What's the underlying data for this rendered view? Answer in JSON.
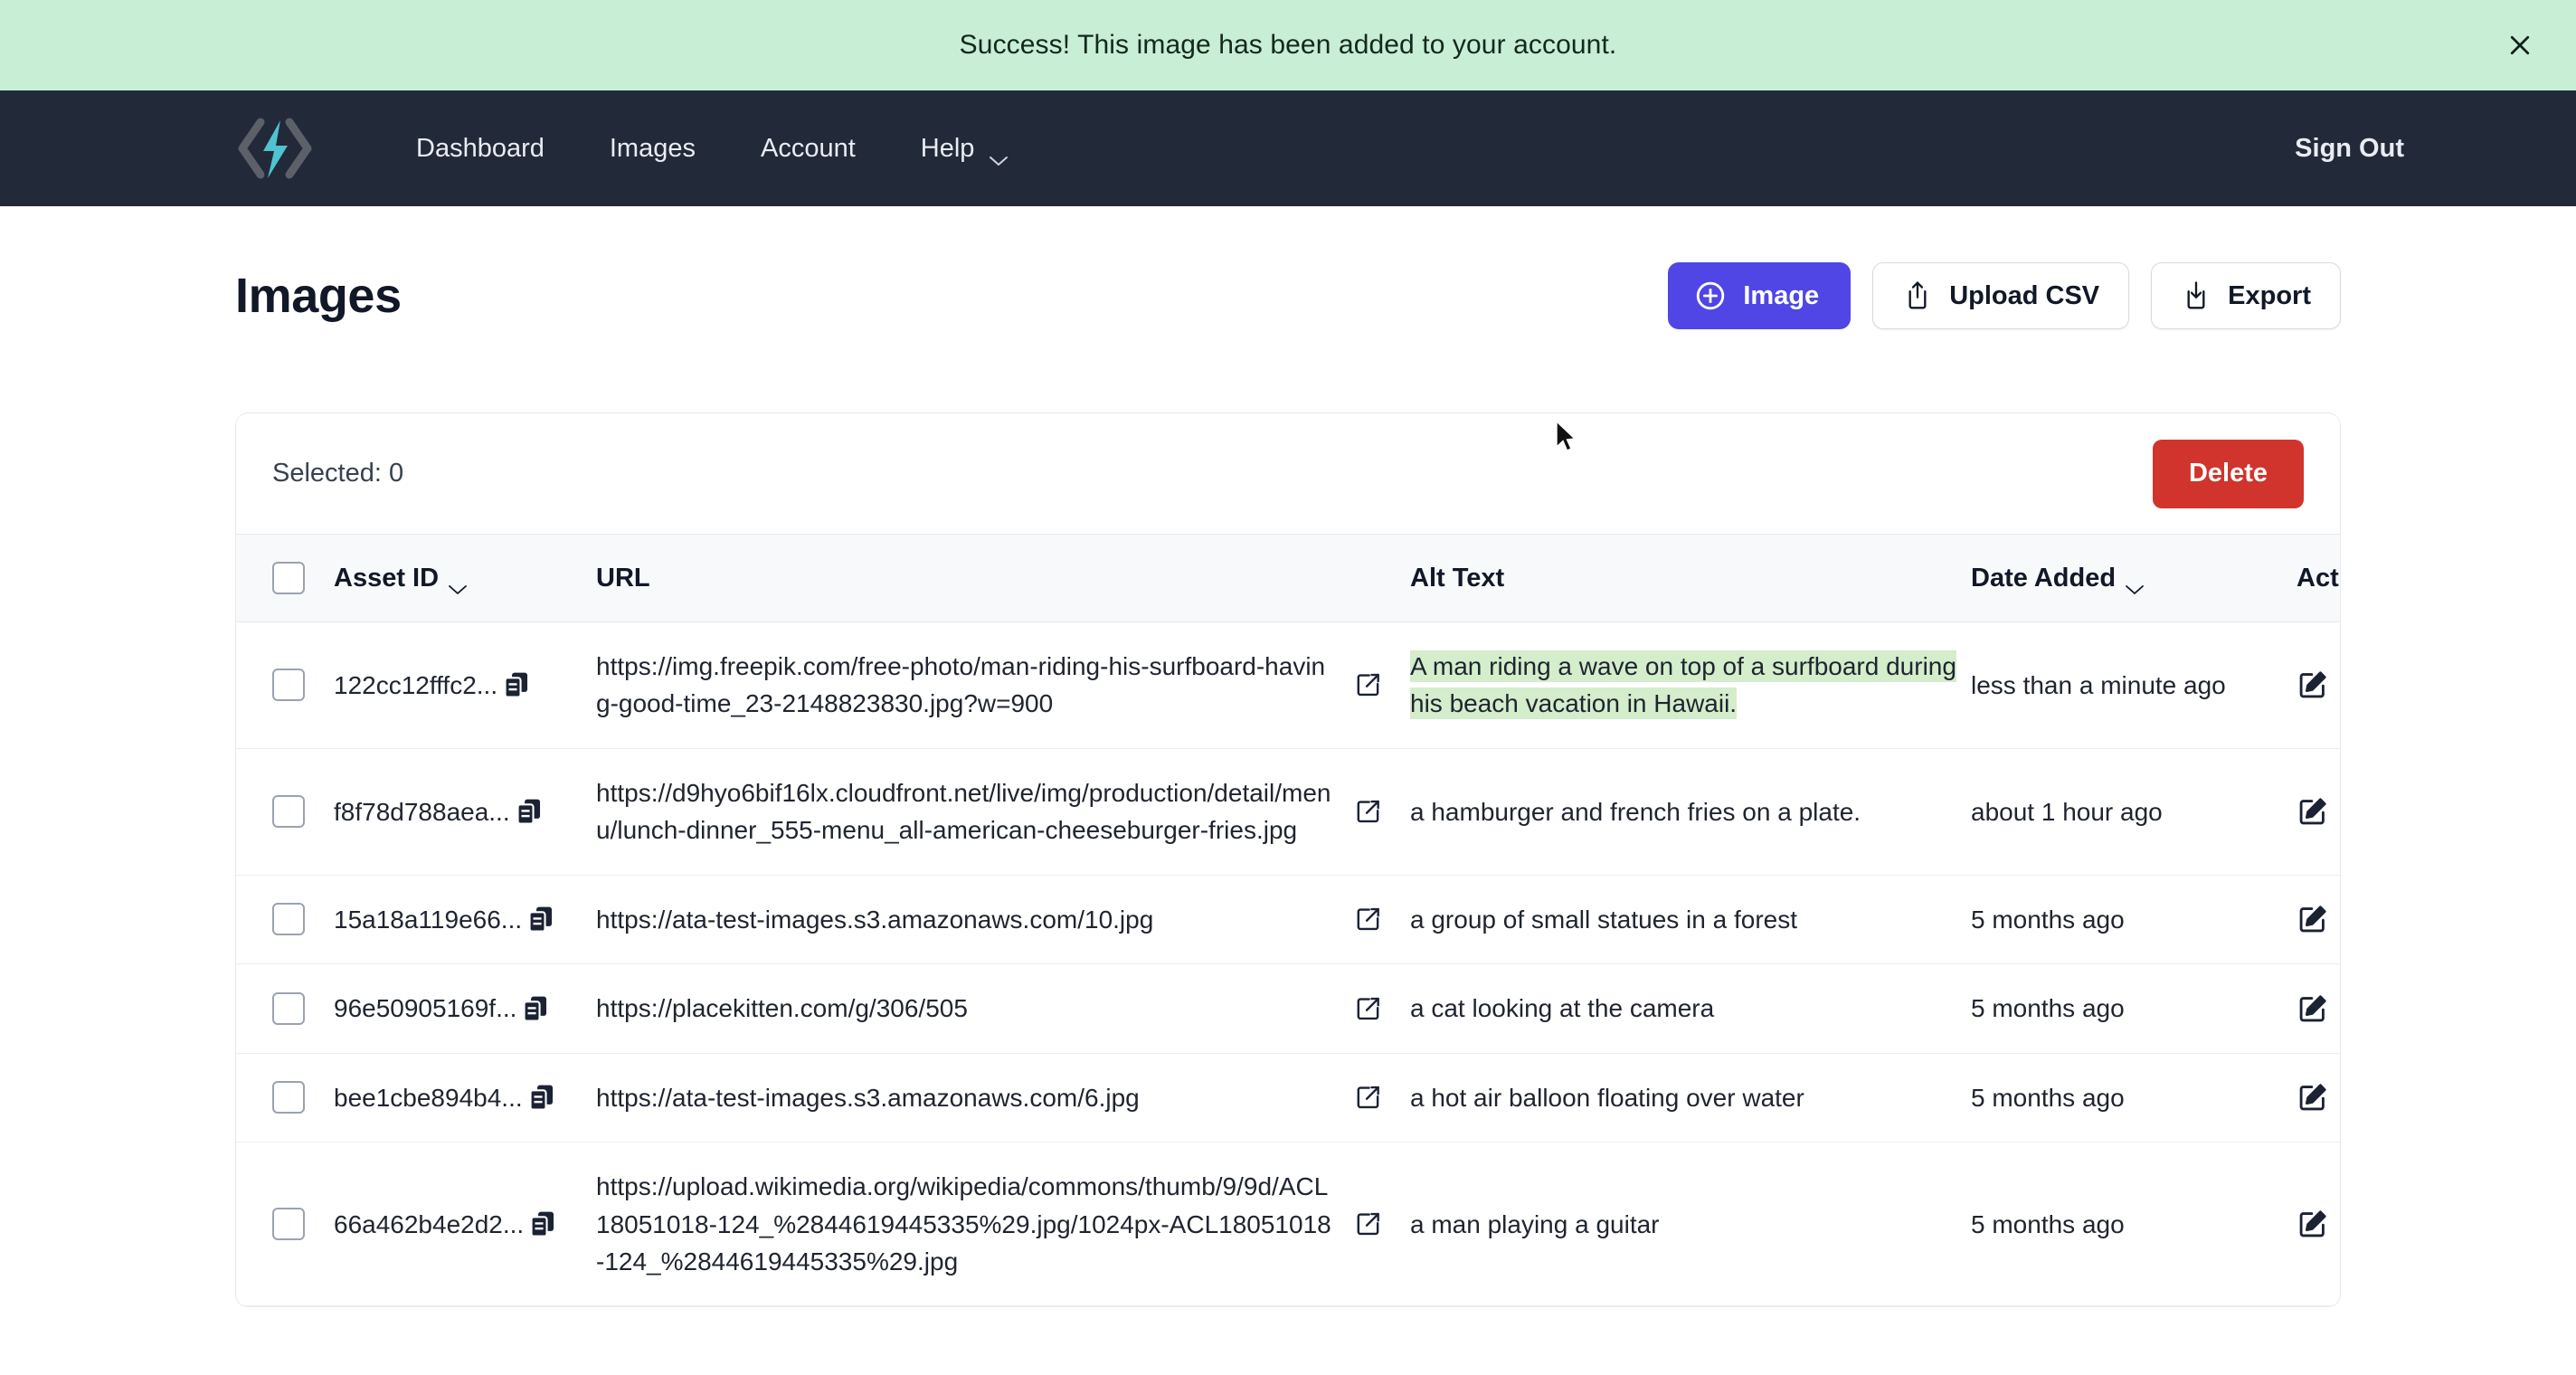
{
  "banner": {
    "message": "Success! This image has been added to your account.",
    "close_icon": "close-icon",
    "bg_color": "#c9eed6"
  },
  "navbar": {
    "logo_icon": "lightning-bolt-code-logo",
    "brand_accent_color": "#4fc3d0",
    "bg_color": "#222938",
    "links": [
      {
        "label": "Dashboard",
        "caret": false
      },
      {
        "label": "Images",
        "caret": false
      },
      {
        "label": "Account",
        "caret": false
      },
      {
        "label": "Help",
        "caret": true
      }
    ],
    "signout_label": "Sign Out"
  },
  "header": {
    "title": "Images",
    "buttons": [
      {
        "label": "Image",
        "icon": "plus-circle-icon",
        "style": "primary",
        "color": "#4f46e5"
      },
      {
        "label": "Upload CSV",
        "icon": "upload-icon",
        "style": "secondary"
      },
      {
        "label": "Export",
        "icon": "download-icon",
        "style": "secondary"
      }
    ]
  },
  "toolbar": {
    "selected_label": "Selected: 0",
    "delete_label": "Delete",
    "delete_color": "#d0342c"
  },
  "table": {
    "columns": [
      {
        "key": "checkbox",
        "label": "",
        "sortable": false
      },
      {
        "key": "asset_id",
        "label": "Asset ID",
        "sortable": true
      },
      {
        "key": "url",
        "label": "URL",
        "sortable": false
      },
      {
        "key": "alt_text",
        "label": "Alt Text",
        "sortable": false
      },
      {
        "key": "date_added",
        "label": "Date Added",
        "sortable": true
      },
      {
        "key": "actions",
        "label": "Actions",
        "sortable": false
      }
    ],
    "row_actions": [
      "edit-icon",
      "users-icon",
      "trash-icon"
    ],
    "rows": [
      {
        "checked": false,
        "asset_id": "122cc12fffc2...",
        "url": "https://img.freepik.com/free-photo/man-riding-his-surfboard-having-good-time_23-2148823830.jpg?w=900",
        "alt_text": "A man riding a wave on top of a surfboard during his beach vacation in Hawaii.",
        "alt_highlighted": true,
        "date_added": "less than a minute ago"
      },
      {
        "checked": false,
        "asset_id": "f8f78d788aea...",
        "url": "https://d9hyo6bif16lx.cloudfront.net/live/img/production/detail/menu/lunch-dinner_555-menu_all-american-cheeseburger-fries.jpg",
        "alt_text": "a hamburger and french fries on a plate.",
        "alt_highlighted": false,
        "date_added": "about 1 hour ago"
      },
      {
        "checked": false,
        "asset_id": "15a18a119e66...",
        "url": "https://ata-test-images.s3.amazonaws.com/10.jpg",
        "alt_text": "a group of small statues in a forest",
        "alt_highlighted": false,
        "date_added": "5 months ago"
      },
      {
        "checked": false,
        "asset_id": "96e50905169f...",
        "url": "https://placekitten.com/g/306/505",
        "alt_text": "a cat looking at the camera",
        "alt_highlighted": false,
        "date_added": "5 months ago"
      },
      {
        "checked": false,
        "asset_id": "bee1cbe894b4...",
        "url": "https://ata-test-images.s3.amazonaws.com/6.jpg",
        "alt_text": "a hot air balloon floating over water",
        "alt_highlighted": false,
        "date_added": "5 months ago"
      },
      {
        "checked": false,
        "asset_id": "66a462b4e2d2...",
        "url": "https://upload.wikimedia.org/wikipedia/commons/thumb/9/9d/ACL18051018-124_%2844619445335%29.jpg/1024px-ACL18051018-124_%2844619445335%29.jpg",
        "alt_text": "a man playing a guitar",
        "alt_highlighted": false,
        "date_added": "5 months ago"
      }
    ]
  }
}
